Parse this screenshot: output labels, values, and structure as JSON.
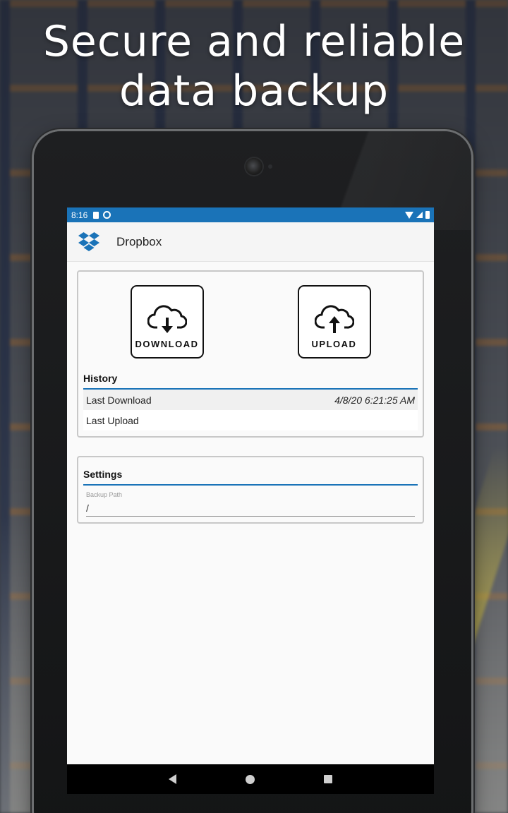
{
  "marketing": {
    "headline_line1": "Secure and reliable",
    "headline_line2": "data backup"
  },
  "status_bar": {
    "time": "8:16"
  },
  "app_bar": {
    "title": "Dropbox",
    "logo_icon": "dropbox-logo-icon",
    "accent_color": "#1a73b8"
  },
  "actions": {
    "download_label": "DOWNLOAD",
    "download_icon": "cloud-download-icon",
    "upload_label": "UPLOAD",
    "upload_icon": "cloud-upload-icon"
  },
  "history": {
    "title": "History",
    "rows": [
      {
        "label": "Last Download",
        "value": "4/8/20 6:21:25 AM"
      },
      {
        "label": "Last Upload",
        "value": ""
      }
    ]
  },
  "settings": {
    "title": "Settings",
    "backup_path_label": "Backup Path",
    "backup_path_value": "/"
  },
  "nav_bar": {
    "back_icon": "back-triangle-icon",
    "home_icon": "home-circle-icon",
    "recents_icon": "recents-square-icon"
  }
}
